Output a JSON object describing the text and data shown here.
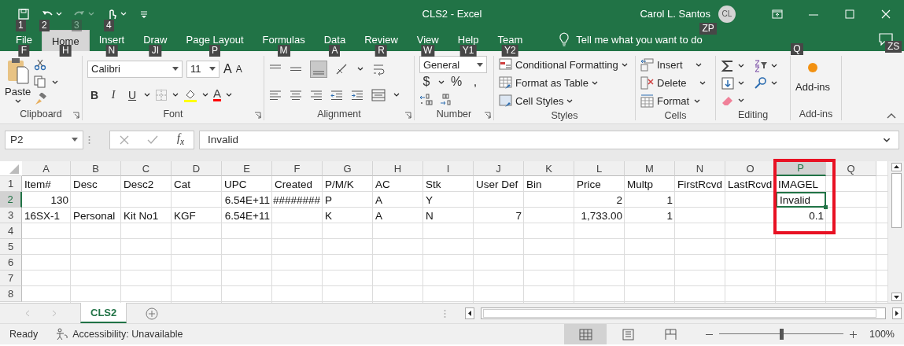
{
  "quick_access": [
    {
      "kind": "save",
      "keytip": "1",
      "disabled": false
    },
    {
      "kind": "undo",
      "keytip": "2",
      "disabled": false
    },
    {
      "kind": "redo",
      "keytip": "3",
      "disabled": true
    },
    {
      "kind": "touch",
      "keytip": "4",
      "disabled": false
    },
    {
      "kind": "customize",
      "disabled": false
    }
  ],
  "window": {
    "title": "CLS2  -  Excel"
  },
  "account": {
    "name": "Carol L. Santos",
    "initials": "CL",
    "keytip": "ZP"
  },
  "tabs": [
    {
      "label": "File",
      "keytip": "F",
      "selected": false
    },
    {
      "label": "Home",
      "keytip": "H",
      "selected": true
    },
    {
      "label": "Insert",
      "keytip": "N",
      "selected": false
    },
    {
      "label": "Draw",
      "keytip": "JI",
      "selected": false
    },
    {
      "label": "Page Layout",
      "keytip": "P",
      "selected": false
    },
    {
      "label": "Formulas",
      "keytip": "M",
      "selected": false
    },
    {
      "label": "Data",
      "keytip": "A",
      "selected": false
    },
    {
      "label": "Review",
      "keytip": "R",
      "selected": false
    },
    {
      "label": "View",
      "keytip": "W",
      "selected": false
    },
    {
      "label": "Help",
      "keytip": "Y1",
      "selected": false
    },
    {
      "label": "Team",
      "keytip": "Y2",
      "selected": false
    }
  ],
  "tell_me": {
    "placeholder": "Tell me what you want to do",
    "keytip": "Q"
  },
  "comments": {
    "keytip": "ZS"
  },
  "ribbon": {
    "clipboard": {
      "label": "Clipboard",
      "paste": "Paste"
    },
    "font": {
      "label": "Font",
      "name": "Calibri",
      "size": "11",
      "grow": "A",
      "shrink": "A",
      "styles": [
        "B",
        "I",
        "U"
      ],
      "color_letter": "A"
    },
    "alignment": {
      "label": "Alignment"
    },
    "number": {
      "label": "Number",
      "format": "General",
      "symbols": [
        "$",
        "%",
        ","
      ]
    },
    "styles": {
      "label": "Styles",
      "commands": [
        "Conditional Formatting",
        "Format as Table",
        "Cell Styles"
      ]
    },
    "cells": {
      "label": "Cells",
      "commands": [
        "Insert",
        "Delete",
        "Format"
      ]
    },
    "editing": {
      "label": "Editing"
    },
    "addins": {
      "label": "Add-ins",
      "button": "Add-ins"
    }
  },
  "formula_bar": {
    "name_box": "P2",
    "function_label": "f$_{x}$",
    "value": "Invalid"
  },
  "sheet": {
    "columns": [
      {
        "label": "A",
        "selected": false,
        "highlighted": false
      },
      {
        "label": "B",
        "selected": false,
        "highlighted": false
      },
      {
        "label": "C",
        "selected": false,
        "highlighted": false
      },
      {
        "label": "D",
        "selected": false,
        "highlighted": false
      },
      {
        "label": "E",
        "selected": false,
        "highlighted": false
      },
      {
        "label": "F",
        "selected": false,
        "highlighted": false
      },
      {
        "label": "G",
        "selected": false,
        "highlighted": false
      },
      {
        "label": "H",
        "selected": false,
        "highlighted": false
      },
      {
        "label": "I",
        "selected": false,
        "highlighted": false
      },
      {
        "label": "J",
        "selected": false,
        "highlighted": false
      },
      {
        "label": "K",
        "selected": false,
        "highlighted": false
      },
      {
        "label": "L",
        "selected": false,
        "highlighted": false
      },
      {
        "label": "M",
        "selected": false,
        "highlighted": false
      },
      {
        "label": "N",
        "selected": false,
        "highlighted": false
      },
      {
        "label": "O",
        "selected": false,
        "highlighted": false
      },
      {
        "label": "P",
        "selected": true,
        "highlighted": true
      },
      {
        "label": "Q",
        "selected": false,
        "highlighted": false
      }
    ],
    "rows": [
      {
        "label": "1",
        "selected": false,
        "cells": [
          {
            "text": "Item#",
            "kind": "text",
            "selected": false
          },
          {
            "text": "Desc",
            "kind": "text",
            "selected": false
          },
          {
            "text": "Desc2",
            "kind": "text",
            "selected": false
          },
          {
            "text": "Cat",
            "kind": "text",
            "selected": false
          },
          {
            "text": "UPC",
            "kind": "text",
            "selected": false
          },
          {
            "text": "Created",
            "kind": "text",
            "selected": false
          },
          {
            "text": "P/M/K",
            "kind": "text",
            "selected": false
          },
          {
            "text": "AC",
            "kind": "text",
            "selected": false
          },
          {
            "text": "Stk",
            "kind": "text",
            "selected": false
          },
          {
            "text": "User Def",
            "kind": "text",
            "selected": false
          },
          {
            "text": "Bin",
            "kind": "text",
            "selected": false
          },
          {
            "text": "Price",
            "kind": "text",
            "selected": false
          },
          {
            "text": "Multp",
            "kind": "text",
            "selected": false
          },
          {
            "text": "FirstRcvd",
            "kind": "text",
            "selected": false
          },
          {
            "text": "LastRcvd",
            "kind": "text",
            "selected": false
          },
          {
            "text": "IMAGEL",
            "kind": "text",
            "selected": false
          },
          null
        ]
      },
      {
        "label": "2",
        "selected": true,
        "cells": [
          {
            "text": "130",
            "kind": "number",
            "selected": false
          },
          null,
          null,
          null,
          {
            "text": "6.54E+11",
            "kind": "number",
            "selected": false
          },
          {
            "text": "########",
            "kind": "number",
            "selected": false
          },
          {
            "text": "P",
            "kind": "text",
            "selected": false
          },
          {
            "text": "A",
            "kind": "text",
            "selected": false
          },
          {
            "text": "Y",
            "kind": "text",
            "selected": false
          },
          null,
          null,
          {
            "text": "2",
            "kind": "number",
            "selected": false
          },
          {
            "text": "1",
            "kind": "number",
            "selected": false
          },
          null,
          null,
          {
            "text": "Invalid",
            "kind": "text",
            "selected": true
          },
          null
        ]
      },
      {
        "label": "3",
        "selected": false,
        "cells": [
          {
            "text": "16SX-1",
            "kind": "text",
            "selected": false
          },
          {
            "text": "Personal",
            "kind": "text",
            "selected": false
          },
          {
            "text": "Kit No1",
            "kind": "text",
            "selected": false
          },
          {
            "text": "KGF",
            "kind": "text",
            "selected": false
          },
          {
            "text": "6.54E+11",
            "kind": "number",
            "selected": false
          },
          null,
          {
            "text": "K",
            "kind": "text",
            "selected": false
          },
          {
            "text": "A",
            "kind": "text",
            "selected": false
          },
          {
            "text": "N",
            "kind": "text",
            "selected": false
          },
          {
            "text": "7",
            "kind": "number",
            "selected": false
          },
          null,
          {
            "text": "1,733.00",
            "kind": "number",
            "selected": false
          },
          {
            "text": "1",
            "kind": "number",
            "selected": false
          },
          null,
          null,
          {
            "text": "0.1",
            "kind": "number",
            "selected": false
          },
          null
        ]
      },
      {
        "label": "4",
        "selected": false
      },
      {
        "label": "5",
        "selected": false
      },
      {
        "label": "6",
        "selected": false
      },
      {
        "label": "7",
        "selected": false
      },
      {
        "label": "8",
        "selected": false
      }
    ]
  },
  "sheet_tabs": [
    {
      "label": "CLS2",
      "selected": true
    }
  ],
  "status_bar": {
    "mode": "Ready",
    "accessibility": "Accessibility: Unavailable",
    "views": [
      {
        "kind": "normal",
        "selected": true
      },
      {
        "kind": "page-layout",
        "selected": false
      },
      {
        "kind": "page-break",
        "selected": false
      }
    ],
    "zoom": {
      "level": 0.5,
      "reading": "100%"
    }
  }
}
